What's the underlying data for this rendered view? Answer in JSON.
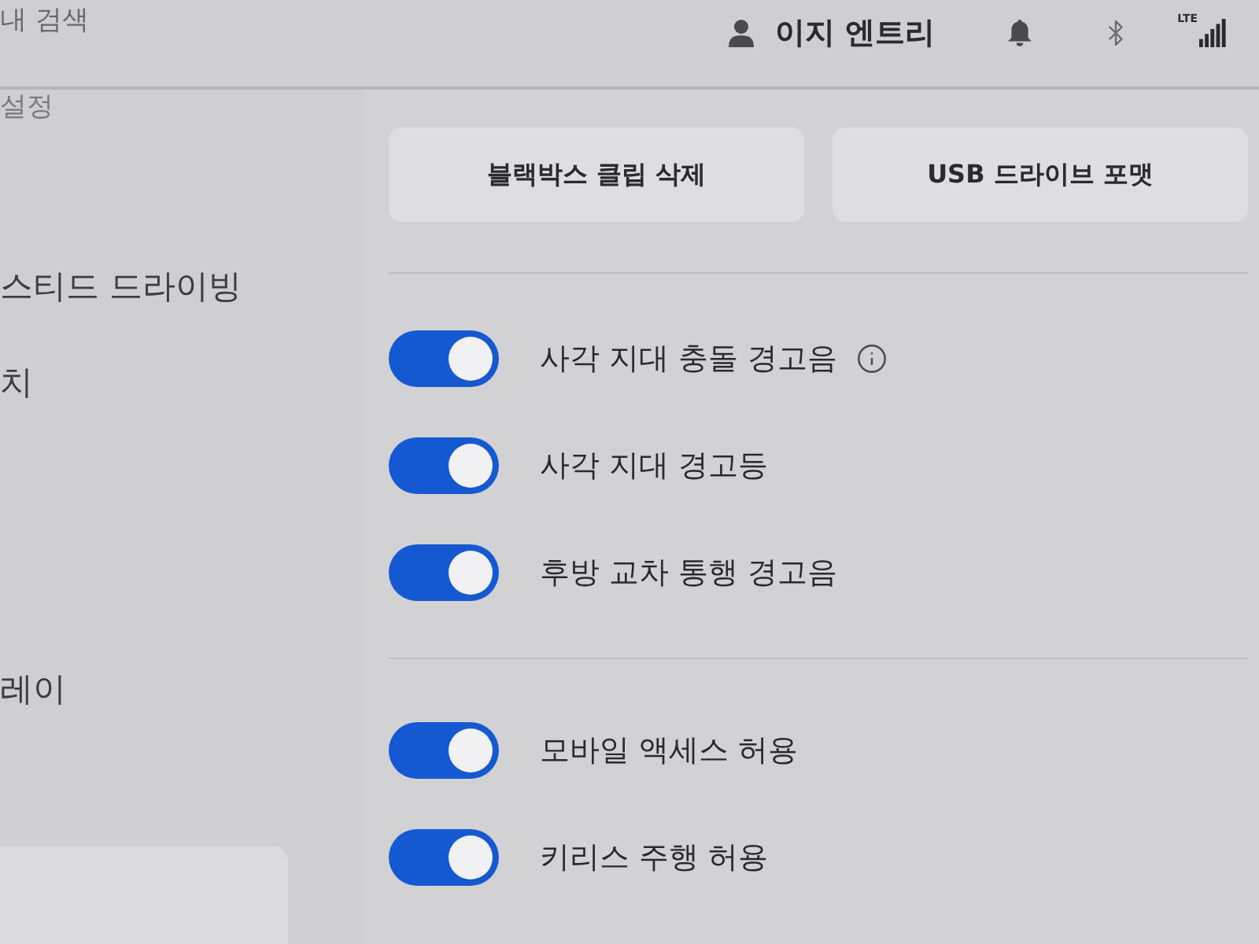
{
  "search": {
    "placeholder": "내 검색"
  },
  "status_bar": {
    "user_name": "이지 엔트리",
    "network": "LTE"
  },
  "sidebar": {
    "items": [
      {
        "label": "설정",
        "kind": "heading"
      },
      {
        "label": "스티드 드라이빙",
        "kind": "item"
      },
      {
        "label": "치",
        "kind": "item"
      },
      {
        "label": "레이",
        "kind": "item"
      }
    ]
  },
  "actions": [
    {
      "label": "블랙박스 클립 삭제"
    },
    {
      "label": "USB 드라이브 포맷"
    }
  ],
  "toggle_groups": [
    {
      "toggles": [
        {
          "label": "사각 지대 충돌 경고음",
          "on": true,
          "info": true
        },
        {
          "label": "사각 지대 경고등",
          "on": true,
          "info": false
        },
        {
          "label": "후방 교차 통행 경고음",
          "on": true,
          "info": false
        }
      ]
    },
    {
      "toggles": [
        {
          "label": "모바일 액세스 허용",
          "on": true,
          "info": false
        },
        {
          "label": "키리스 주행 허용",
          "on": true,
          "info": false
        }
      ]
    }
  ]
}
